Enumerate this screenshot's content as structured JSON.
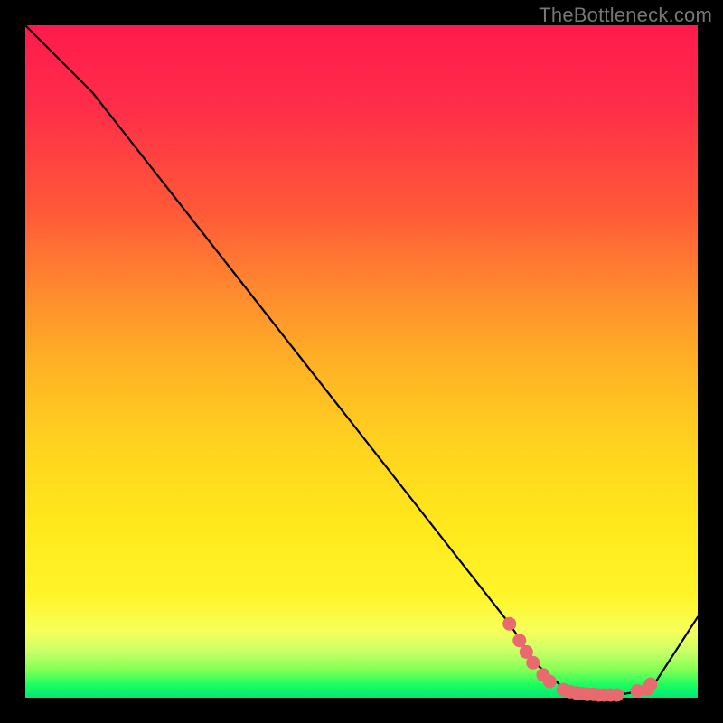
{
  "watermark": "TheBottleneck.com",
  "chart_data": {
    "type": "line",
    "title": "",
    "xlabel": "",
    "ylabel": "",
    "xlim": [
      0,
      100
    ],
    "ylim": [
      0,
      100
    ],
    "series": [
      {
        "name": "curve",
        "x": [
          0,
          6,
          10,
          72,
          76,
          80,
          82,
          84,
          86,
          88,
          93,
          100
        ],
        "values": [
          100,
          94,
          90,
          11,
          5,
          1.5,
          0.8,
          0.5,
          0.4,
          0.4,
          1.2,
          12
        ]
      }
    ],
    "markers": [
      {
        "x": 72.0,
        "y": 11.0
      },
      {
        "x": 73.5,
        "y": 8.5
      },
      {
        "x": 74.5,
        "y": 6.8
      },
      {
        "x": 75.5,
        "y": 5.2
      },
      {
        "x": 77.0,
        "y": 3.4
      },
      {
        "x": 78.0,
        "y": 2.4
      },
      {
        "x": 80.0,
        "y": 1.2
      },
      {
        "x": 81.0,
        "y": 0.9
      },
      {
        "x": 82.0,
        "y": 0.7
      },
      {
        "x": 82.8,
        "y": 0.6
      },
      {
        "x": 83.6,
        "y": 0.5
      },
      {
        "x": 84.5,
        "y": 0.5
      },
      {
        "x": 85.3,
        "y": 0.4
      },
      {
        "x": 86.1,
        "y": 0.4
      },
      {
        "x": 87.0,
        "y": 0.4
      },
      {
        "x": 88.0,
        "y": 0.4
      },
      {
        "x": 91.0,
        "y": 1.0
      },
      {
        "x": 92.5,
        "y": 1.3
      },
      {
        "x": 93.0,
        "y": 2.0
      }
    ],
    "marker_style": {
      "color": "#e96a6e",
      "radius_px": 7
    },
    "background_gradient": {
      "stops": [
        {
          "pos": 0.0,
          "color": "#ff1a4d"
        },
        {
          "pos": 0.4,
          "color": "#ff8c2e"
        },
        {
          "pos": 0.74,
          "color": "#ffe81c"
        },
        {
          "pos": 0.9,
          "color": "#f7ff5a"
        },
        {
          "pos": 1.0,
          "color": "#00e874"
        }
      ]
    }
  }
}
